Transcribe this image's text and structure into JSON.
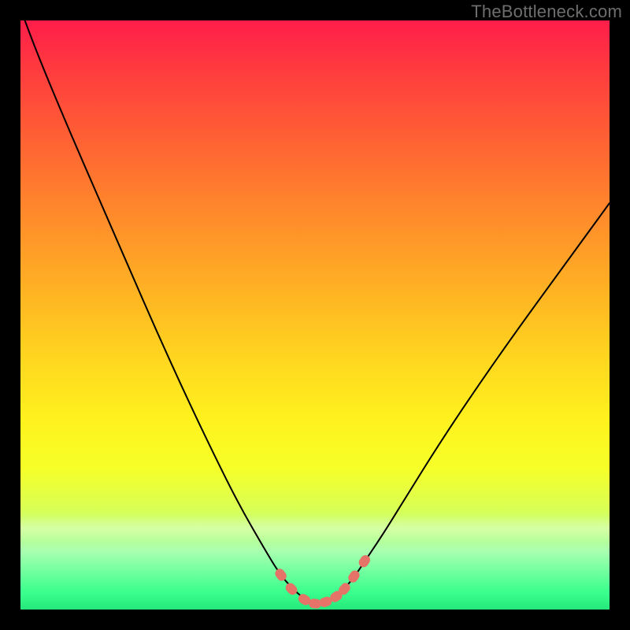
{
  "watermark": "TheBottleneck.com",
  "colors": {
    "frame": "#000000",
    "gradient_top": "#ff1d4a",
    "gradient_bottom": "#25e87a",
    "curve": "#000000",
    "marker": "#e57368"
  },
  "chart_data": {
    "type": "line",
    "title": "",
    "xlabel": "",
    "ylabel": "",
    "xlim": [
      0,
      100
    ],
    "ylim": [
      0,
      100
    ],
    "x": [
      0,
      3,
      8,
      13,
      18,
      23,
      28,
      33,
      37,
      41,
      44,
      46.5,
      48.5,
      50,
      51.5,
      53,
      55,
      57,
      59,
      62,
      66,
      71,
      77,
      84,
      92,
      100
    ],
    "values": [
      102,
      94,
      82,
      70.5,
      59,
      47.5,
      36.5,
      26,
      18,
      11,
      6,
      3.2,
      1.6,
      1.0,
      1.2,
      1.9,
      3.5,
      6,
      9,
      13.5,
      20,
      28,
      37,
      47,
      58,
      69
    ],
    "markers_x": [
      44.2,
      46.0,
      48.2,
      50.0,
      51.8,
      53.6,
      55.0,
      56.6,
      58.4
    ],
    "markers_y": [
      5.9,
      3.5,
      1.7,
      1.0,
      1.3,
      2.2,
      3.5,
      5.6,
      8.2
    ],
    "annotations": []
  }
}
